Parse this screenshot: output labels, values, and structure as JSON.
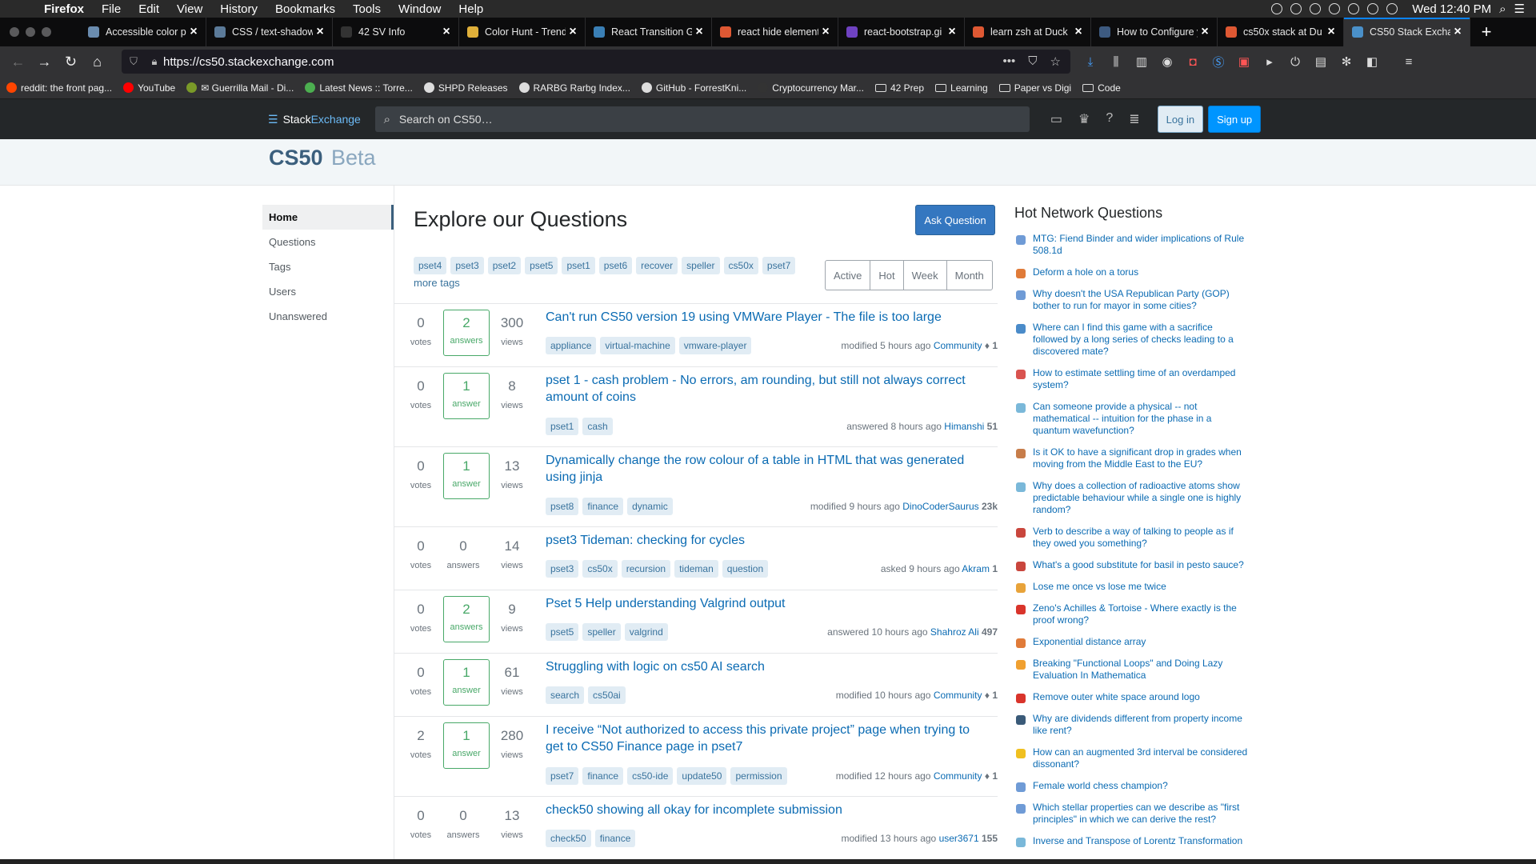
{
  "menubar": {
    "app": "Firefox",
    "items": [
      "File",
      "Edit",
      "View",
      "History",
      "Bookmarks",
      "Tools",
      "Window",
      "Help"
    ],
    "clock": "Wed 12:40 PM"
  },
  "tabs": [
    {
      "title": "Accessible color p",
      "color": "#6a8caf"
    },
    {
      "title": "CSS / text-shadow",
      "color": "#5b7a99"
    },
    {
      "title": "42 SV Info",
      "color": "#333333"
    },
    {
      "title": "Color Hunt - Trend",
      "color": "#e0b03a"
    },
    {
      "title": "React Transition G",
      "color": "#3a7fb5"
    },
    {
      "title": "react hide element",
      "color": "#de5833"
    },
    {
      "title": "react-bootstrap.gi",
      "color": "#6f42c1"
    },
    {
      "title": "learn zsh at Duck",
      "color": "#de5833"
    },
    {
      "title": "How to Configure y",
      "color": "#3d5a80"
    },
    {
      "title": "cs50x stack at Du",
      "color": "#de5833"
    },
    {
      "title": "CS50 Stack Excha",
      "color": "#4a90c9"
    }
  ],
  "url": "https://cs50.stackexchange.com",
  "bookmarks": [
    {
      "label": "reddit: the front pag...",
      "color": "#ff4500",
      "folder": false
    },
    {
      "label": "YouTube",
      "color": "#ff0000",
      "folder": false
    },
    {
      "label": "✉ Guerrilla Mail - Di...",
      "color": "#7a9a28",
      "folder": false
    },
    {
      "label": "Latest News :: Torre...",
      "color": "#4caf50",
      "folder": false
    },
    {
      "label": "SHPD Releases",
      "color": "#dddddd",
      "folder": false
    },
    {
      "label": "RARBG Rarbg Index...",
      "color": "#dddddd",
      "folder": false
    },
    {
      "label": "GitHub - ForrestKni...",
      "color": "#dddddd",
      "folder": false
    },
    {
      "label": "Cryptocurrency Mar...",
      "color": "#333333",
      "folder": false
    },
    {
      "label": "42 Prep",
      "color": "",
      "folder": true
    },
    {
      "label": "Learning",
      "color": "",
      "folder": true
    },
    {
      "label": "Paper vs Digi",
      "color": "",
      "folder": true
    },
    {
      "label": "Code",
      "color": "",
      "folder": true
    }
  ],
  "se": {
    "logo_stack": "Stack",
    "logo_exchange": "Exchange",
    "search_placeholder": "Search on CS50…",
    "login": "Log in",
    "signup": "Sign up"
  },
  "site": {
    "title": "CS50",
    "badge": "Beta"
  },
  "leftnav": [
    "Home",
    "Questions",
    "Tags",
    "Users",
    "Unanswered"
  ],
  "main": {
    "title": "Explore our Questions",
    "ask_button": "Ask Question",
    "tags": [
      "pset4",
      "pset3",
      "pset2",
      "pset5",
      "pset1",
      "pset6",
      "recover",
      "speller",
      "cs50x",
      "pset7"
    ],
    "more_tags": "more tags",
    "filters": [
      "Active",
      "Hot",
      "Week",
      "Month"
    ]
  },
  "questions": [
    {
      "votes": "0",
      "votes_label": "votes",
      "answers": "2",
      "answers_label": "answers",
      "answered": true,
      "views": "300",
      "views_label": "views",
      "title": "Can't run CS50 version 19 using VMWare Player - The file is too large",
      "tags": [
        "appliance",
        "virtual-machine",
        "vmware-player"
      ],
      "meta_action": "modified 5 hours ago",
      "user": "Community",
      "rep": "♦ 1"
    },
    {
      "votes": "0",
      "votes_label": "votes",
      "answers": "1",
      "answers_label": "answer",
      "answered": true,
      "views": "8",
      "views_label": "views",
      "title": "pset 1 - cash problem - No errors, am rounding, but still not always correct amount of coins",
      "tags": [
        "pset1",
        "cash"
      ],
      "meta_action": "answered 8 hours ago",
      "user": "Himanshi",
      "rep": "51"
    },
    {
      "votes": "0",
      "votes_label": "votes",
      "answers": "1",
      "answers_label": "answer",
      "answered": true,
      "views": "13",
      "views_label": "views",
      "title": "Dynamically change the row colour of a table in HTML that was generated using jinja",
      "tags": [
        "pset8",
        "finance",
        "dynamic"
      ],
      "meta_action": "modified 9 hours ago",
      "user": "DinoCoderSaurus",
      "rep": "23k"
    },
    {
      "votes": "0",
      "votes_label": "votes",
      "answers": "0",
      "answers_label": "answers",
      "answered": false,
      "views": "14",
      "views_label": "views",
      "title": "pset3 Tideman: checking for cycles",
      "tags": [
        "pset3",
        "cs50x",
        "recursion",
        "tideman",
        "question"
      ],
      "meta_action": "asked 9 hours ago",
      "user": "Akram",
      "rep": "1"
    },
    {
      "votes": "0",
      "votes_label": "votes",
      "answers": "2",
      "answers_label": "answers",
      "answered": true,
      "views": "9",
      "views_label": "views",
      "title": "Pset 5 Help understanding Valgrind output",
      "tags": [
        "pset5",
        "speller",
        "valgrind"
      ],
      "meta_action": "answered 10 hours ago",
      "user": "Shahroz Ali",
      "rep": "497"
    },
    {
      "votes": "0",
      "votes_label": "votes",
      "answers": "1",
      "answers_label": "answer",
      "answered": true,
      "views": "61",
      "views_label": "views",
      "title": "Struggling with logic on cs50 AI search",
      "tags": [
        "search",
        "cs50ai"
      ],
      "meta_action": "modified 10 hours ago",
      "user": "Community",
      "rep": "♦ 1"
    },
    {
      "votes": "2",
      "votes_label": "votes",
      "answers": "1",
      "answers_label": "answer",
      "answered": true,
      "views": "280",
      "views_label": "views",
      "title": "I receive “Not authorized to access this private project” page when trying to get to CS50 Finance page in pset7",
      "tags": [
        "pset7",
        "finance",
        "cs50-ide",
        "update50",
        "permission"
      ],
      "meta_action": "modified 12 hours ago",
      "user": "Community",
      "rep": "♦ 1"
    },
    {
      "votes": "0",
      "votes_label": "votes",
      "answers": "0",
      "answers_label": "answers",
      "answered": false,
      "views": "13",
      "views_label": "views",
      "title": "check50 showing all okay for incomplete submission",
      "tags": [
        "check50",
        "finance"
      ],
      "meta_action": "modified 13 hours ago",
      "user": "user3671",
      "rep": "155"
    }
  ],
  "sidebar": {
    "title": "Hot Network Questions",
    "items": [
      {
        "text": "MTG: Fiend Binder and wider implications of Rule 508.1d",
        "color": "#6f9bd6"
      },
      {
        "text": "Deform a hole on a torus",
        "color": "#e07b39"
      },
      {
        "text": "Why doesn't the USA Republican Party (GOP) bother to run for mayor in some cities?",
        "color": "#6f9bd6"
      },
      {
        "text": "Where can I find this game with a sacrifice followed by a long series of checks leading to a discovered mate?",
        "color": "#4a8bc9"
      },
      {
        "text": "How to estimate settling time of an overdamped system?",
        "color": "#d9534f"
      },
      {
        "text": "Can someone provide a physical -- not mathematical -- intuition for the phase in a quantum wavefunction?",
        "color": "#7ab8d9"
      },
      {
        "text": "Is it OK to have a significant drop in grades when moving from the Middle East to the EU?",
        "color": "#c77d4a"
      },
      {
        "text": "Why does a collection of radioactive atoms show predictable behaviour while a single one is highly random?",
        "color": "#7ab8d9"
      },
      {
        "text": "Verb to describe a way of talking to people as if they owed you something?",
        "color": "#c9463d"
      },
      {
        "text": "What's a good substitute for basil in pesto sauce?",
        "color": "#c9463d"
      },
      {
        "text": "Lose me once vs lose me twice",
        "color": "#e8a33a"
      },
      {
        "text": "Zeno's Achilles & Tortoise - Where exactly is the proof wrong?",
        "color": "#d9342b"
      },
      {
        "text": "Exponential distance array",
        "color": "#e07b39"
      },
      {
        "text": "Breaking \"Functional Loops\" and Doing Lazy Evaluation In Mathematica",
        "color": "#f0a030"
      },
      {
        "text": "Remove outer white space around logo",
        "color": "#d9342b"
      },
      {
        "text": "Why are dividends different from property income like rent?",
        "color": "#3a5a78"
      },
      {
        "text": "How can an augmented 3rd interval be considered dissonant?",
        "color": "#f0c020"
      },
      {
        "text": "Female world chess champion?",
        "color": "#6f9bd6"
      },
      {
        "text": "Which stellar properties can we describe as \"first principles\" in which we can derive the rest?",
        "color": "#6f9bd6"
      },
      {
        "text": "Inverse and Transpose of Lorentz Transformation",
        "color": "#7ab8d9"
      }
    ]
  }
}
